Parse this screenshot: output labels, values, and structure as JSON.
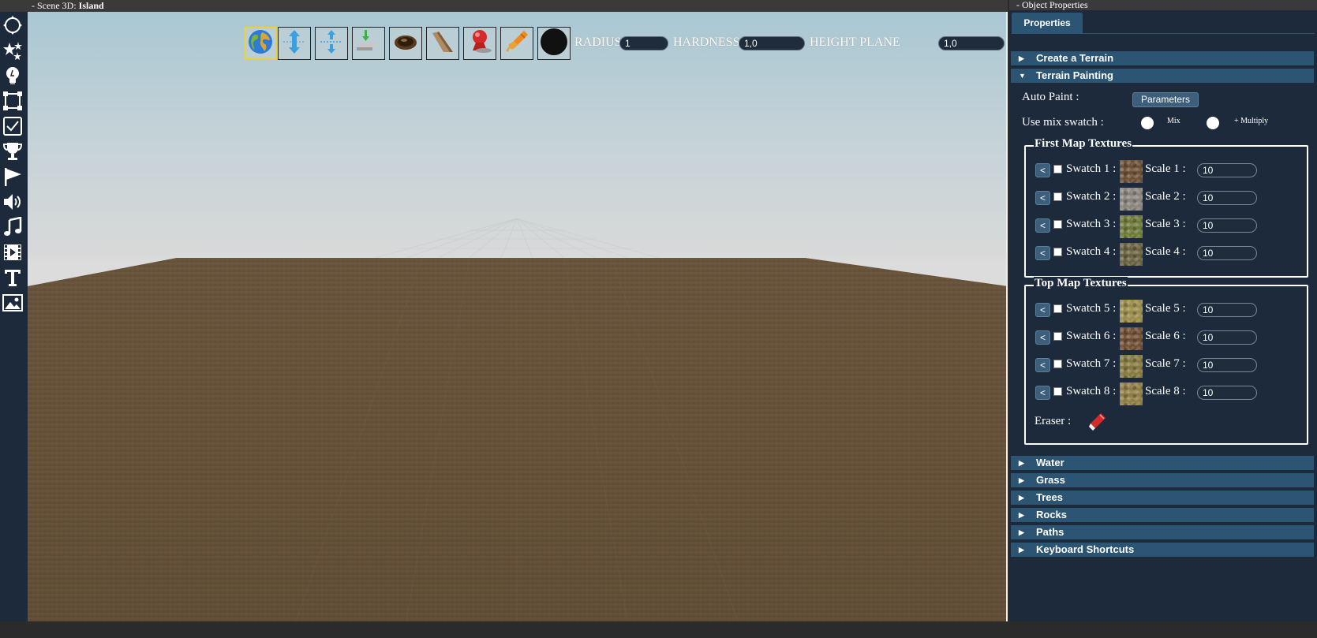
{
  "scene": {
    "title_prefix": "- Scene 3D: ",
    "title_name": "Island"
  },
  "left_tools": [
    {
      "icon": "transform-icon"
    },
    {
      "icon": "effects-icon"
    },
    {
      "icon": "light-bulb-icon"
    },
    {
      "icon": "selection-box-icon"
    },
    {
      "icon": "checkbox-icon"
    },
    {
      "icon": "trophy-icon"
    },
    {
      "icon": "flag-icon"
    },
    {
      "icon": "speaker-icon"
    },
    {
      "icon": "music-note-icon"
    },
    {
      "icon": "video-icon"
    },
    {
      "icon": "text-icon"
    },
    {
      "icon": "image-icon"
    }
  ],
  "terrain_toolbar": {
    "tools": [
      {
        "icon": "globe-icon",
        "selected": true
      },
      {
        "icon": "raise-lower-icon",
        "selected": false
      },
      {
        "icon": "flatten-icon",
        "selected": false
      },
      {
        "icon": "height-plane-icon",
        "selected": false
      },
      {
        "icon": "dig-hole-icon",
        "selected": false
      },
      {
        "icon": "slope-icon",
        "selected": false
      },
      {
        "icon": "smooth-icon",
        "selected": false
      },
      {
        "icon": "paint-brush-icon",
        "selected": false
      },
      {
        "icon": "brush-shape-icon",
        "selected": false
      }
    ],
    "radius_label": "RADIUS",
    "radius_value": "1",
    "hardness_label": "HARDNESS",
    "hardness_value": "1,0",
    "height_plane_label": "HEIGHT PLANE",
    "height_plane_value": "1,0"
  },
  "properties": {
    "window_title": "- Object Properties",
    "tab_label": "Properties",
    "sections": {
      "create_terrain": "Create a Terrain",
      "terrain_painting": "Terrain Painting",
      "water": "Water",
      "grass": "Grass",
      "trees": "Trees",
      "rocks": "Rocks",
      "paths": "Paths",
      "keyboard_shortcuts": "Keyboard Shortcuts"
    },
    "auto_paint_label": "Auto Paint :",
    "parameters_button": "Parameters",
    "use_mix_swatch_label": "Use mix swatch :",
    "mix_label": "Mix",
    "multiply_label": "+ Multiply",
    "first_map_title": "First Map Textures",
    "top_map_title": "Top Map Textures",
    "back_label": "<",
    "first_map_rows": [
      {
        "swatch_label": "Swatch 1 :",
        "scale_label": "Scale 1 :",
        "scale_value": "10",
        "texture": "dirt",
        "color": "#6b5035"
      },
      {
        "swatch_label": "Swatch 2 :",
        "scale_label": "Scale 2 :",
        "scale_value": "10",
        "texture": "rock",
        "color": "#8a857c"
      },
      {
        "swatch_label": "Swatch 3 :",
        "scale_label": "Scale 3 :",
        "scale_value": "10",
        "texture": "grass",
        "color": "#6e7a3c"
      },
      {
        "swatch_label": "Swatch 4 :",
        "scale_label": "Scale 4 :",
        "scale_value": "10",
        "texture": "mossy-dirt",
        "color": "#6a6240"
      }
    ],
    "top_map_rows": [
      {
        "swatch_label": "Swatch 5 :",
        "scale_label": "Scale 5 :",
        "scale_value": "10",
        "texture": "dry-grass",
        "color": "#9a8c4a"
      },
      {
        "swatch_label": "Swatch 6 :",
        "scale_label": "Scale 6 :",
        "scale_value": "10",
        "texture": "soil",
        "color": "#6f4e33"
      },
      {
        "swatch_label": "Swatch 7 :",
        "scale_label": "Scale 7 :",
        "scale_value": "10",
        "texture": "meadow",
        "color": "#857a40"
      },
      {
        "swatch_label": "Swatch 8 :",
        "scale_label": "Scale 8 :",
        "scale_value": "10",
        "texture": "sand-grass",
        "color": "#8f7d44"
      }
    ],
    "eraser_label": "Eraser :"
  },
  "colors": {
    "panel_bg": "#1c2a3b",
    "accent": "#2c5473",
    "ground": "#6a5640",
    "sky_top": "#a9c7d3"
  }
}
